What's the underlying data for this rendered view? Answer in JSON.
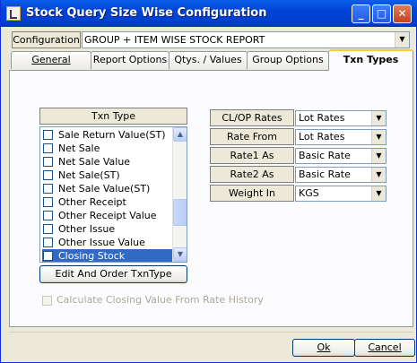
{
  "window": {
    "title": "Stock Query Size Wise Configuration"
  },
  "config": {
    "label": "Configuration",
    "value": "GROUP + ITEM WISE STOCK REPORT"
  },
  "tabs": [
    "General",
    "Report Options",
    "Qtys. / Values",
    "Group Options",
    "Txn Types"
  ],
  "txn": {
    "header": "Txn Type",
    "items": [
      {
        "label": "Sale Return Value(ST)",
        "checked": false,
        "selected": false
      },
      {
        "label": "Net Sale",
        "checked": false,
        "selected": false
      },
      {
        "label": "Net Sale Value",
        "checked": false,
        "selected": false
      },
      {
        "label": "Net Sale(ST)",
        "checked": false,
        "selected": false
      },
      {
        "label": "Net Sale Value(ST)",
        "checked": false,
        "selected": false
      },
      {
        "label": "Other Receipt",
        "checked": false,
        "selected": false
      },
      {
        "label": "Other Receipt Value",
        "checked": false,
        "selected": false
      },
      {
        "label": "Other Issue",
        "checked": false,
        "selected": false
      },
      {
        "label": "Other Issue Value",
        "checked": false,
        "selected": false
      },
      {
        "label": "Closing Stock",
        "checked": true,
        "selected": true
      }
    ],
    "edit_button": "Edit And Order TxnType"
  },
  "rates": {
    "rows": [
      {
        "label": "CL/OP Rates",
        "value": "Lot Rates"
      },
      {
        "label": "Rate From",
        "value": "Lot Rates"
      },
      {
        "label": "Rate1 As",
        "value": "Basic Rate"
      },
      {
        "label": "Rate2 As",
        "value": "Basic Rate"
      },
      {
        "label": "Weight In",
        "value": "KGS"
      }
    ]
  },
  "calc_closing_label": "Calculate Closing Value From Rate History",
  "buttons": {
    "ok": "Ok",
    "cancel": "Cancel"
  },
  "colors": {
    "titlebar": "#0043d6",
    "selection": "#316ac5",
    "active_tab_accent": "#ffc83c"
  }
}
